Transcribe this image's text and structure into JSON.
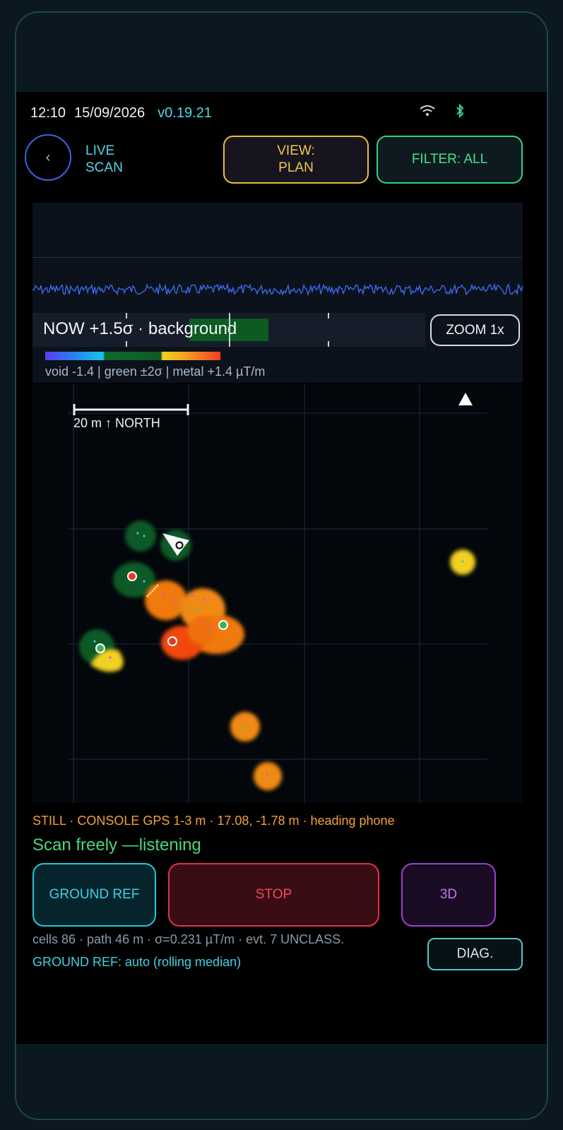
{
  "status_bar": {
    "time": "12:10",
    "date": "15/09/2026",
    "version": "v0.19.21",
    "wifi_icon": "wifi-icon",
    "bluetooth_icon": "bluetooth-icon"
  },
  "header": {
    "back_icon": "chevron-left-icon",
    "mode_line1": "LIVE",
    "mode_line2": "SCAN",
    "view_line1": "VIEW:",
    "view_line2": "PLAN",
    "filter_label": "FILTER: ALL"
  },
  "signal": {
    "now_label": "NOW +1.5σ · background",
    "zoom_label": "ZOOM 1x",
    "legend": "void -1.4 | green ±2σ | metal +1.4 µT/m",
    "colors": {
      "void": "#5a3cf0",
      "green": "#0f5a26",
      "metal": "#f04020",
      "trace": "#3f68e8"
    }
  },
  "map": {
    "scale_label": "20 m  ↑ NORTH",
    "north_marker_icon": "north-arrow-icon",
    "heading_icon": "heading-arrow-icon"
  },
  "gps_line": "STILL · CONSOLE GPS 1-3 m · 17.08, -1.78 m · heading phone",
  "status_line": "Scan freely —listening",
  "buttons": {
    "ground_ref": "GROUND REF",
    "stop": "STOP",
    "three_d": "3D",
    "diag": "DIAG."
  },
  "stats_line": "cells 86 · path 46 m · σ=0.231 µT/m · evt. 7 UNCLASS.",
  "ground_ref_line": "GROUND REF: auto (rolling median)"
}
